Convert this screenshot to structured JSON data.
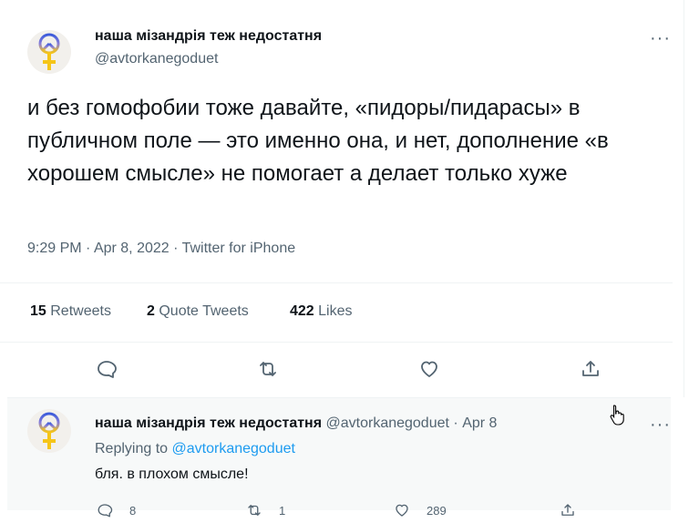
{
  "tweet": {
    "display_name": "наша мізандрія теж недостатня",
    "handle": "@avtorkanegoduet",
    "text": "и без гомофобии тоже давайте, «пидоры/пидарасы» в публичном поле — это именно она, и нет, дополнение «в хорошем смысле» не помогает а делает только хуже",
    "time": "9:29 PM",
    "sep": "·",
    "date": "Apr 8, 2022",
    "source": "Twitter for iPhone",
    "more_label": "···"
  },
  "stats": {
    "retweets_count": "15",
    "retweets_label": "Retweets",
    "quotes_count": "2",
    "quotes_label": "Quote Tweets",
    "likes_count": "422",
    "likes_label": "Likes"
  },
  "reply": {
    "display_name": "наша мізандрія теж недостатня",
    "handle": "@avtorkanegoduet",
    "sep": "·",
    "date": "Apr 8",
    "replying_prefix": "Replying to",
    "replying_handle": "@avtorkanegoduet",
    "text": "бля. в плохом смысле!",
    "more_label": "···",
    "reply_count": "8",
    "retweet_count": "1",
    "like_count": "289"
  },
  "colors": {
    "accent": "#1d9bf0",
    "secondary_text": "#536471",
    "avatar_symbol_top": "#3b5bdb",
    "avatar_symbol_bottom": "#f5c518"
  }
}
